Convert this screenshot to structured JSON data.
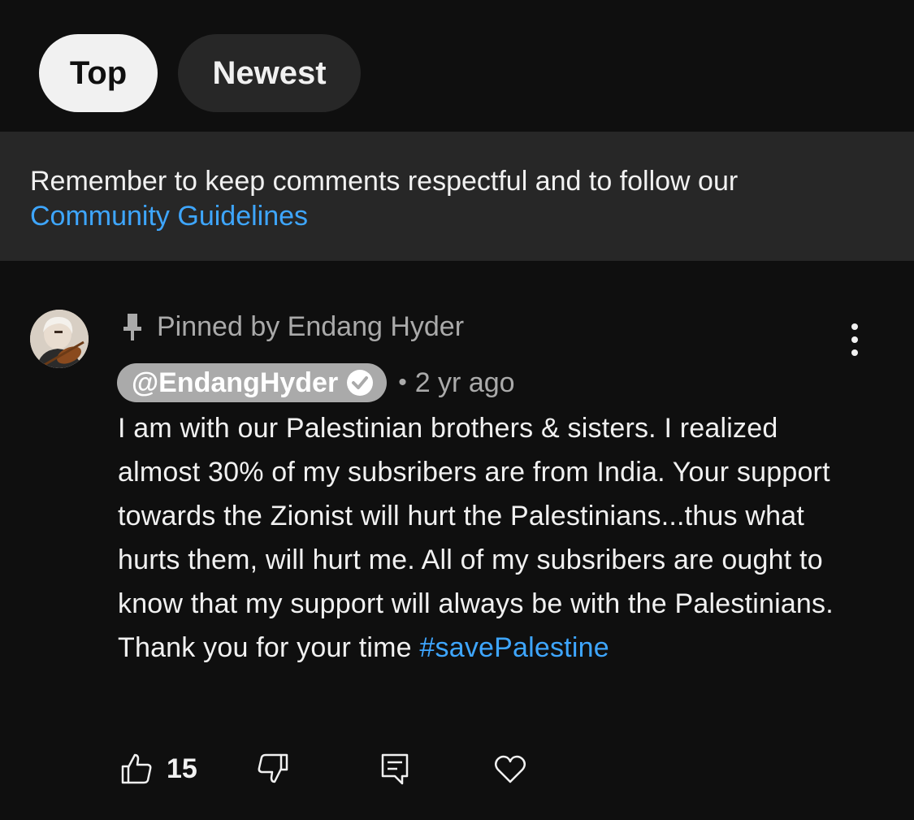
{
  "sort_chips": [
    {
      "label": "Top",
      "active": true
    },
    {
      "label": "Newest",
      "active": false
    }
  ],
  "notice": {
    "text": "Remember to keep comments respectful and to follow our",
    "link_label": "Community Guidelines"
  },
  "comment": {
    "pinned_label": "Pinned by Endang Hyder",
    "author_handle": "@EndangHyder",
    "verified": true,
    "separator": "•",
    "timestamp": "2 yr ago",
    "body_text": "I am with our Palestinian brothers & sisters. I realized almost 30% of my subsribers are from India. Your support towards the Zionist will hurt the Palestinians...thus what hurts them, will hurt me. All of my subsribers are ought to know that my support will always be with the Palestinians. Thank you for your time ",
    "hashtag": "#savePalestine",
    "like_count": "15"
  },
  "icons": {
    "pin": "pin-icon",
    "more": "more-vertical-icon",
    "verified": "verified-check-icon",
    "like": "thumbs-up-icon",
    "dislike": "thumbs-down-icon",
    "reply": "reply-comment-icon",
    "heart": "heart-icon"
  },
  "colors": {
    "background": "#0f0f0f",
    "notice_background": "#272727",
    "link": "#3ea6ff",
    "secondary_text": "#aaaaaa"
  }
}
